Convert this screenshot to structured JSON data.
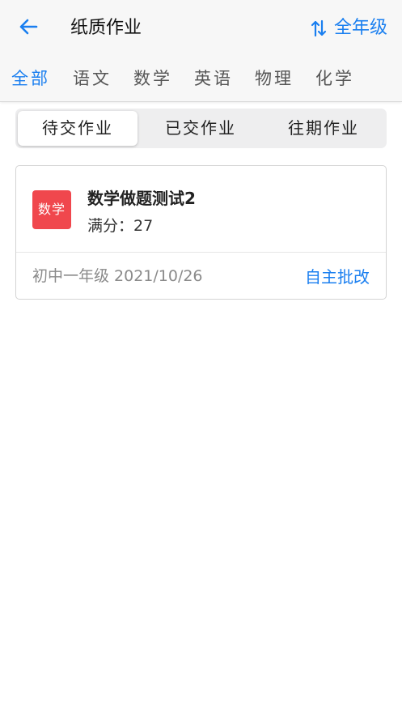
{
  "header": {
    "title": "纸质作业",
    "back_icon": "arrow-left-icon",
    "grade_filter": {
      "icon": "sort-icon",
      "label": "全年级"
    }
  },
  "subject_tabs": [
    {
      "label": "全部",
      "active": true
    },
    {
      "label": "语文",
      "active": false
    },
    {
      "label": "数学",
      "active": false
    },
    {
      "label": "英语",
      "active": false
    },
    {
      "label": "物理",
      "active": false
    },
    {
      "label": "化学",
      "active": false
    }
  ],
  "status_tabs": [
    {
      "label": "待交作业",
      "active": true
    },
    {
      "label": "已交作业",
      "active": false
    },
    {
      "label": "往期作业",
      "active": false
    }
  ],
  "homework": [
    {
      "subject_badge": "数学",
      "title": "数学做题测试2",
      "score_label": "满分：",
      "score_value": "27",
      "grade": "初中一年级",
      "date": "2021/10/26",
      "action": "自主批改"
    }
  ],
  "colors": {
    "accent": "#1a7ff0",
    "badge_math": "#f0474d",
    "header_bg": "#f7f7f7"
  }
}
